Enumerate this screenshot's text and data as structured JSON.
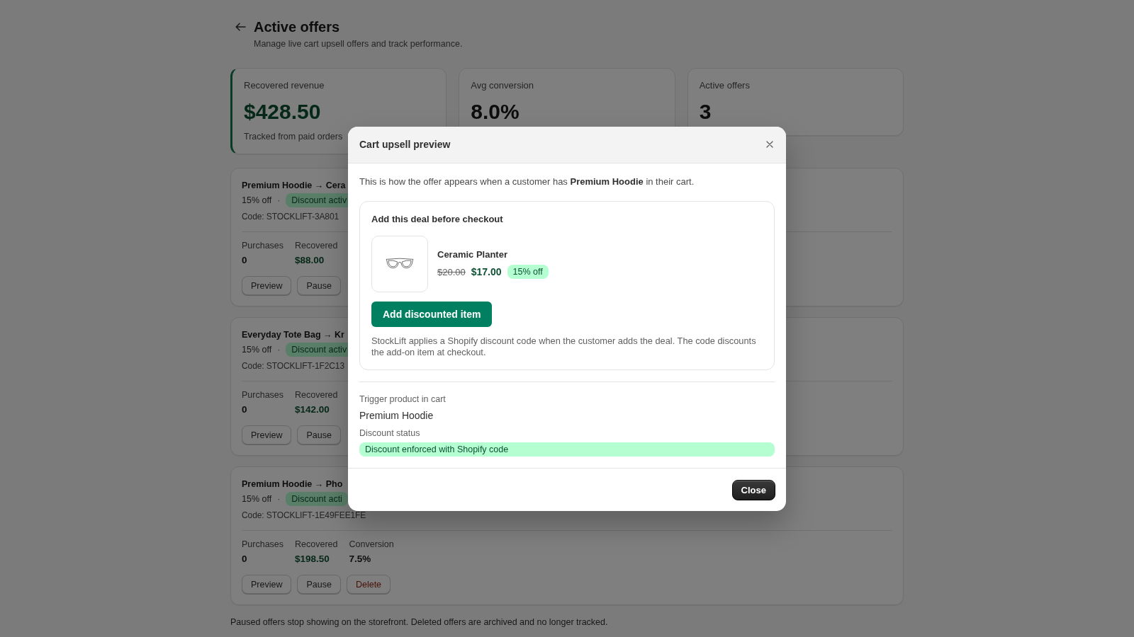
{
  "header": {
    "title": "Active offers",
    "subtitle": "Manage live cart upsell offers and track performance."
  },
  "stats": [
    {
      "label": "Recovered revenue",
      "value": "$428.50",
      "note": "Tracked from paid orders",
      "highlighted": true
    },
    {
      "label": "Avg conversion",
      "value": "8.0%",
      "highlighted": false
    },
    {
      "label": "Active offers",
      "value": "3",
      "highlighted": false
    }
  ],
  "offers": [
    {
      "title": "Premium Hoodie → Cera",
      "discount": "15% off",
      "separator": "·",
      "badge": "Discount activ",
      "code": "Code: STOCKLIFT-3A801",
      "stats": [
        {
          "label": "Purchases",
          "value": "0",
          "kind": "count"
        },
        {
          "label": "Recovered",
          "value": "$88.00",
          "kind": "money"
        }
      ],
      "actions": [
        {
          "label": "Preview",
          "kind": "preview"
        },
        {
          "label": "Pause",
          "kind": "pause"
        }
      ]
    },
    {
      "title": "Everyday Tote Bag → Kr",
      "discount": "15% off",
      "separator": "·",
      "badge": "Discount activ",
      "code": "Code: STOCKLIFT-1F2C13",
      "stats": [
        {
          "label": "Purchases",
          "value": "0",
          "kind": "count"
        },
        {
          "label": "Recovered",
          "value": "$142.00",
          "kind": "money"
        }
      ],
      "actions": [
        {
          "label": "Preview",
          "kind": "preview"
        },
        {
          "label": "Pause",
          "kind": "pause"
        }
      ]
    },
    {
      "title": "Premium Hoodie → Pho",
      "discount": "15% off",
      "separator": "·",
      "badge": "Discount acti",
      "code": "Code: STOCKLIFT-1E49FEE1FE",
      "stats": [
        {
          "label": "Purchases",
          "value": "0",
          "kind": "count"
        },
        {
          "label": "Recovered",
          "value": "$198.50",
          "kind": "money"
        },
        {
          "label": "Conversion",
          "value": "7.5%",
          "kind": "percent"
        }
      ],
      "actions": [
        {
          "label": "Preview",
          "kind": "preview"
        },
        {
          "label": "Pause",
          "kind": "pause"
        },
        {
          "label": "Delete",
          "kind": "delete"
        }
      ]
    }
  ],
  "footer_note": "Paused offers stop showing on the storefront. Deleted offers are archived and no longer tracked.",
  "modal": {
    "title": "Cart upsell preview",
    "intro": "This is how the offer appears when a customer has **Premium Hoodie** in their cart.",
    "preview": {
      "heading": "Add this deal before checkout",
      "product": {
        "name": "Ceramic Planter",
        "original_price": "$20.00",
        "price": "$17.00",
        "badge": "15% off"
      },
      "button": "Add discounted item",
      "note": "StockLift applies a Shopify discount code when the customer adds the deal. The code discounts the add-on item at checkout."
    },
    "fields": [
      {
        "label": "Trigger product in cart",
        "value": "Premium Hoodie",
        "kind": "text"
      },
      {
        "label": "Discount status",
        "value": "Discount enforced with Shopify code",
        "kind": "status"
      }
    ],
    "close_button": "Close"
  }
}
